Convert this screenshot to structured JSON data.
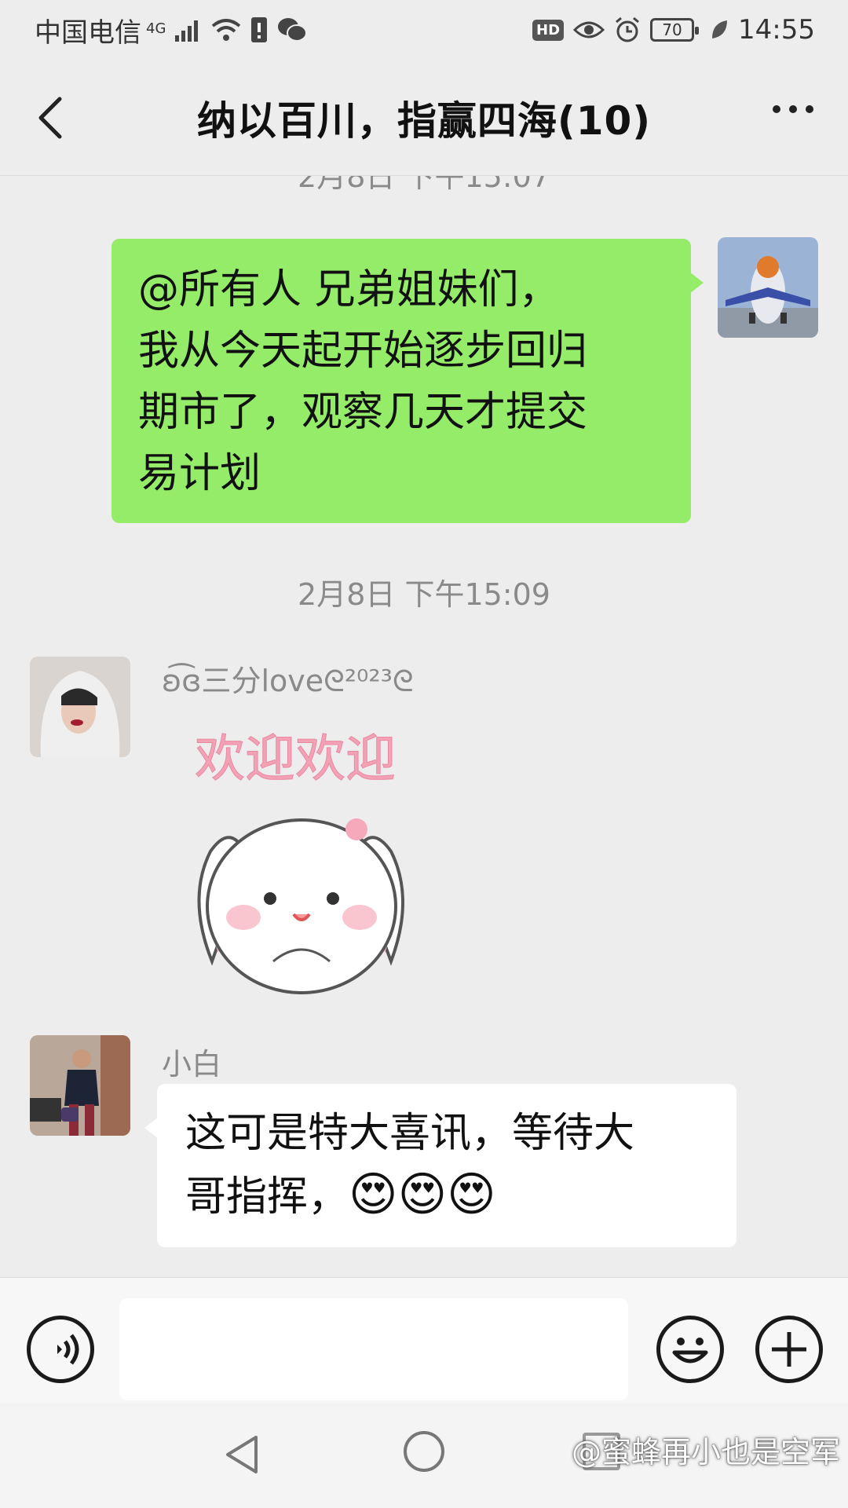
{
  "status_bar": {
    "carrier": "中国电信",
    "network": "4G",
    "hd": "HD",
    "battery": "70",
    "time": "14:55"
  },
  "header": {
    "title": "纳以百川，指赢四海(10)"
  },
  "timestamps": {
    "top_partial": "2月8日 下午15:07",
    "middle": "2月8日 下午15:09"
  },
  "messages": [
    {
      "type": "outgoing",
      "lines": [
        "@所有人  兄弟姐妹们，",
        "我从今天起开始逐步回归",
        "期市了，观察几天才提交",
        "易计划"
      ]
    },
    {
      "type": "incoming_sticker",
      "sender": "ʚ͡ɞ三分loveᘓ²⁰²³ᘓ",
      "sticker_text": "欢迎欢迎"
    },
    {
      "type": "incoming",
      "sender": "小白",
      "lines": [
        "这可是特大喜讯，等待大",
        "哥指挥，"
      ],
      "emojis": "😍😍😍"
    }
  ],
  "input": {
    "placeholder": ""
  },
  "watermark": "@蜜蜂再小也是空军",
  "colors": {
    "outgoing_bubble": "#95ec69",
    "incoming_bubble": "#ffffff",
    "background": "#ededed"
  }
}
